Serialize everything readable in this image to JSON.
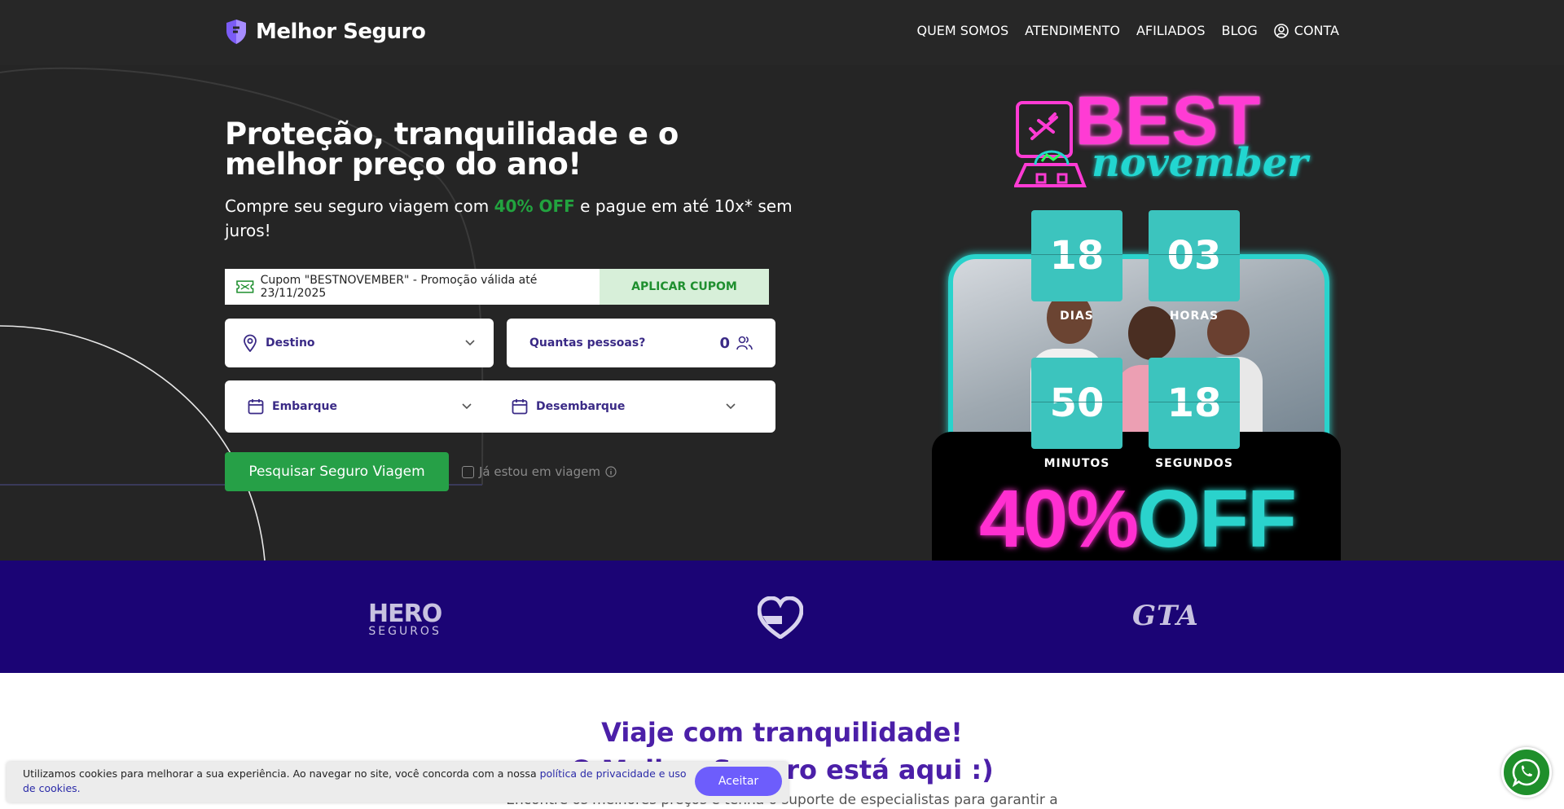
{
  "header": {
    "brand": "Melhor Seguro",
    "nav": [
      "QUEM SOMOS",
      "ATENDIMENTO",
      "AFILIADOS",
      "BLOG"
    ],
    "account": "CONTA"
  },
  "hero": {
    "title": "Proteção, tranquilidade e o melhor preço do ano!",
    "subtitle_pre": "Compre seu seguro viagem com ",
    "subtitle_highlight": "40% OFF",
    "subtitle_post": " e pague em até 10x* sem juros!",
    "coupon_text": "Cupom \"BESTNOVEMBER\" - Promoção válida até 23/11/2025",
    "coupon_button": "APLICAR CUPOM",
    "destination_label": "Destino",
    "people_label": "Quantas pessoas?",
    "people_count": "0",
    "departure_label": "Embarque",
    "return_label": "Desembarque",
    "search_button": "Pesquisar Seguro Viagem",
    "traveling_label": "Já estou em viagem"
  },
  "promo": {
    "title_best": "BEST",
    "title_november": "november",
    "countdown": [
      {
        "value": "18",
        "label": "DIAS"
      },
      {
        "value": "03",
        "label": "HORAS"
      },
      {
        "value": "50",
        "label": "MINUTOS"
      },
      {
        "value": "18",
        "label": "SEGUNDOS"
      }
    ],
    "discount_pct": "40%",
    "discount_off": "OFF"
  },
  "partners": {
    "hero_a": "HERO",
    "hero_b": "SEGUROS",
    "gta": "GTA"
  },
  "content": {
    "title_line1": "Viaje com tranquilidade!",
    "title_line2": "O Melhor Seguro está aqui :)",
    "subtitle": "Encontre os melhores preços e tenha o suporte de especialistas para garantir a"
  },
  "cookie": {
    "text": "Utilizamos cookies para melhorar a sua experiência. Ao navegar no site, você concorda com a nossa ",
    "link": "política de privacidade e uso de cookies.",
    "button": "Aceitar"
  },
  "colors": {
    "header_bg": "#272727",
    "partners_bg": "#1b0475",
    "accent_green": "#26a047",
    "accent_purple": "#4b1fa8",
    "neon_pink": "#ff2fd0",
    "neon_cyan": "#2ad3cc"
  }
}
